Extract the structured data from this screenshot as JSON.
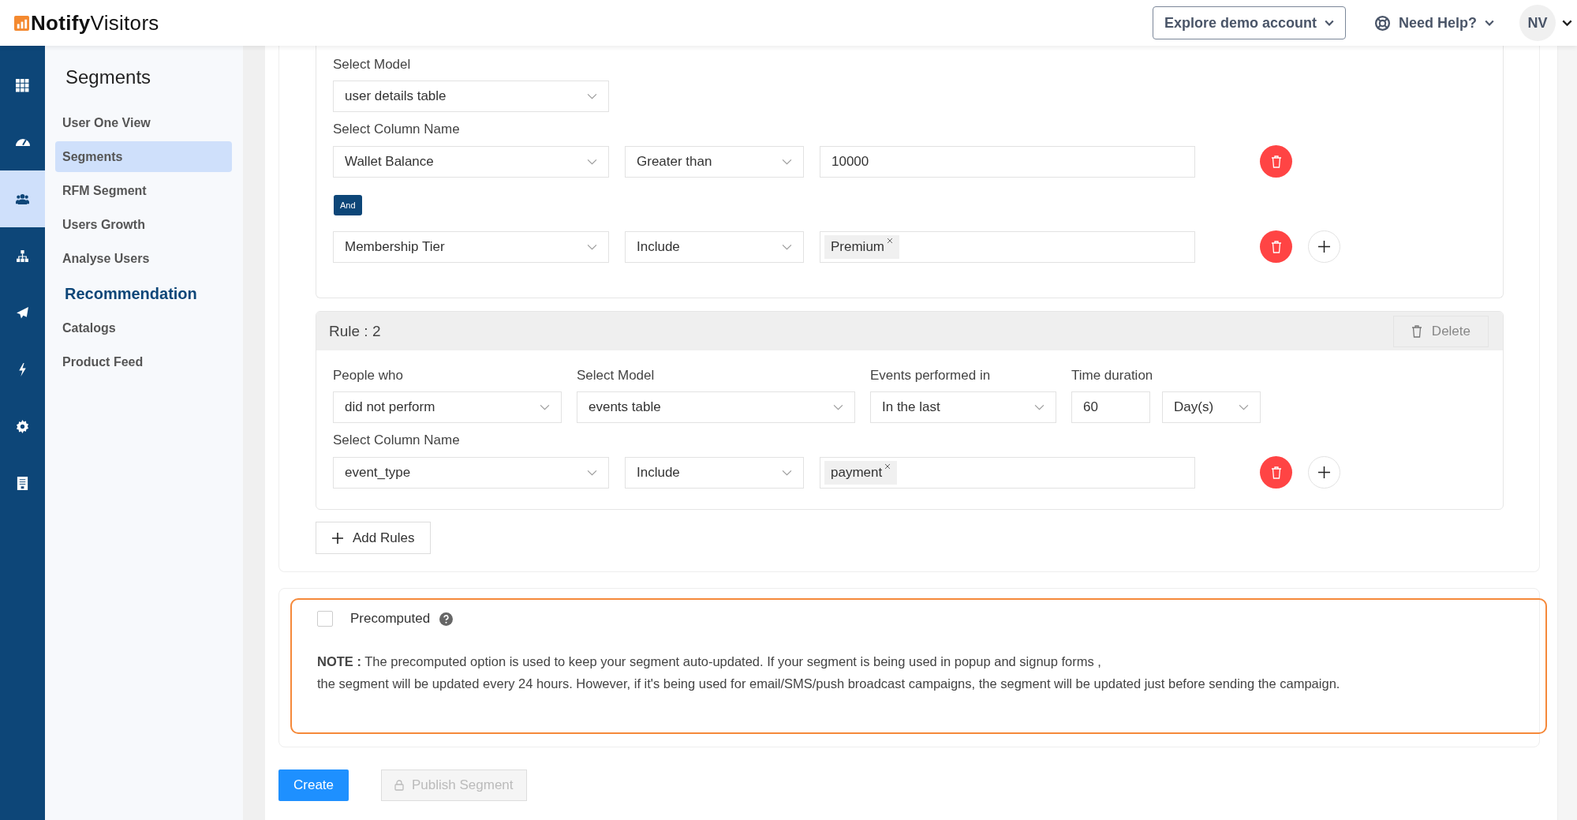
{
  "header": {
    "logo": "**Notify**Visitors",
    "explore_button": "Explore demo account",
    "help": "Need Help?",
    "avatar": "NV"
  },
  "rail": [
    {
      "kind": "grid",
      "selected": false
    },
    {
      "kind": "dashboard",
      "selected": false
    },
    {
      "kind": "users",
      "selected": true
    },
    {
      "kind": "sitemap",
      "selected": false
    },
    {
      "kind": "send",
      "selected": false
    },
    {
      "kind": "bolt",
      "selected": false
    },
    {
      "kind": "gear",
      "selected": false
    },
    {
      "kind": "document",
      "selected": false
    }
  ],
  "sidebar": {
    "title": "Segments",
    "items": [
      {
        "label": "User One View",
        "selected": false
      },
      {
        "label": "Segments",
        "selected": true
      },
      {
        "label": "RFM Segment",
        "selected": false
      },
      {
        "label": "Users Growth",
        "selected": false
      },
      {
        "label": "Analyse Users",
        "selected": false
      }
    ],
    "section": "Recommendation",
    "section_items": [
      {
        "label": "Catalogs",
        "selected": false
      },
      {
        "label": "Product Feed",
        "selected": false
      }
    ]
  },
  "rule_1": {
    "model_label": "Select Model",
    "model": "user details table",
    "column_label": "Select Column Name",
    "connector": "And",
    "conditions": [
      {
        "column": "Wallet Balance",
        "operator": "Greater than",
        "kind": "text",
        "value": "10000",
        "add": false
      },
      {
        "column": "Membership Tier",
        "operator": "Include",
        "kind": "tags",
        "tags": [
          "Premium"
        ],
        "add": true
      }
    ]
  },
  "rule_2": {
    "title": "Rule : 2",
    "delete": "Delete",
    "fields": [
      {
        "label": "People who",
        "kind": "select",
        "value": "did not perform"
      },
      {
        "label": "Select Model",
        "kind": "select",
        "value": "events table"
      },
      {
        "label": "Events performed in",
        "kind": "select",
        "value": "In the last"
      },
      {
        "label": "Time duration",
        "kind": "input",
        "value": "60"
      },
      {
        "kind": "select",
        "value": "Day(s)"
      }
    ],
    "column_label": "Select Column Name",
    "conditions": [
      {
        "column": "event_type",
        "operator": "Include",
        "kind": "tags",
        "tags": [
          "payment"
        ],
        "add": true
      }
    ]
  },
  "add_rules": "Add Rules",
  "precomputed": {
    "label": "Precomputed",
    "checked": false,
    "note_1": "**NOTE :** The precomputed option is used to keep your segment auto-updated. If your segment is being used in popup and signup forms ,",
    "note_2": "the segment will be updated every 24 hours. However, if it's being used for email/SMS/push broadcast campaigns, the segment will be updated just before sending the campaign."
  },
  "buttons": {
    "create": "Create",
    "publish": "Publish Segment",
    "publish_disabled": true
  }
}
